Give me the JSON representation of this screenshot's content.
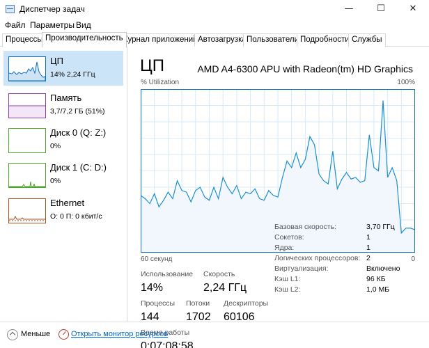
{
  "window": {
    "title": "Диспетчер задач",
    "minimize_glyph": "—",
    "maximize_glyph": "☐",
    "close_glyph": "✕"
  },
  "menu": [
    "Файл",
    "Параметры",
    "Вид"
  ],
  "tabs": [
    "Процессы",
    "Производительность",
    "Журнал приложений",
    "Автозагрузка",
    "Пользователи",
    "Подробности",
    "Службы"
  ],
  "active_tab_index": 1,
  "sidebar": {
    "items": [
      {
        "name": "ЦП",
        "sub": "14% 2,24 ГГц",
        "color": "#1170c2",
        "selected": true
      },
      {
        "name": "Память",
        "sub": "3,7/7,2 ГБ (51%)",
        "color": "#8e3fae",
        "selected": false
      },
      {
        "name": "Диск 0 (Q: Z:)",
        "sub": "0%",
        "color": "#4ea72e",
        "selected": false
      },
      {
        "name": "Диск 1 (C: D:)",
        "sub": "0%",
        "color": "#4ea72e",
        "selected": false
      },
      {
        "name": "Ethernet",
        "sub": "О: 0 П: 0 кбит/с",
        "color": "#a7521d",
        "selected": false
      }
    ]
  },
  "main": {
    "title": "ЦП",
    "model": "AMD A4-6300 APU with Radeon(tm) HD Graphics",
    "graph_label": "% Utilization",
    "graph_max": "100%",
    "graph_time": "60 секунд",
    "graph_min": "0"
  },
  "stats": {
    "usage_label": "Использование",
    "usage_value": "14%",
    "speed_label": "Скорость",
    "speed_value": "2,24 ГГц",
    "processes_label": "Процессы",
    "processes_value": "144",
    "threads_label": "Потоки",
    "threads_value": "1702",
    "handles_label": "Дескрипторы",
    "handles_value": "60106",
    "uptime_label": "Время работы",
    "uptime_value": "0:07:08:58"
  },
  "details": [
    {
      "key": "Базовая скорость:",
      "value": "3,70 ГГц"
    },
    {
      "key": "Сокетов:",
      "value": "1"
    },
    {
      "key": "Ядра:",
      "value": "1"
    },
    {
      "key": "Логических процессоров:",
      "value": "2"
    },
    {
      "key": "Виртуализация:",
      "value": "Включено"
    },
    {
      "key": "Кэш L1:",
      "value": "96 КБ"
    },
    {
      "key": "Кэш L2:",
      "value": "1,0 МБ"
    }
  ],
  "footer": {
    "fewer_label": "Меньше",
    "monitor_link": "Открыть монитор ресурсов"
  },
  "chart_data": {
    "type": "area",
    "ylabel": "% Utilization",
    "xlabel": "60 секунд",
    "ylim": [
      0,
      100
    ],
    "x": [
      60,
      59,
      58,
      57,
      56,
      55,
      54,
      53,
      52,
      51,
      50,
      49,
      48,
      47,
      46,
      45,
      44,
      43,
      42,
      41,
      40,
      39,
      38,
      37,
      36,
      35,
      34,
      33,
      32,
      31,
      30,
      29,
      28,
      27,
      26,
      25,
      24,
      23,
      22,
      21,
      20,
      19,
      18,
      17,
      16,
      15,
      14,
      13,
      12,
      11,
      10,
      9,
      8,
      7,
      6,
      5,
      4,
      3,
      2,
      1,
      0
    ],
    "series": [
      {
        "values": [
          35,
          33,
          30,
          36,
          28,
          32,
          37,
          33,
          44,
          38,
          37,
          31,
          38,
          40,
          34,
          32,
          40,
          33,
          46,
          40,
          36,
          41,
          33,
          37,
          36,
          39,
          33,
          32,
          38,
          35,
          34,
          46,
          56,
          52,
          61,
          52,
          57,
          71,
          66,
          48,
          44,
          42,
          62,
          39,
          45,
          49,
          45,
          46,
          43,
          44,
          72,
          52,
          50,
          93,
          46,
          52,
          44,
          12,
          15,
          15,
          14
        ]
      }
    ]
  }
}
